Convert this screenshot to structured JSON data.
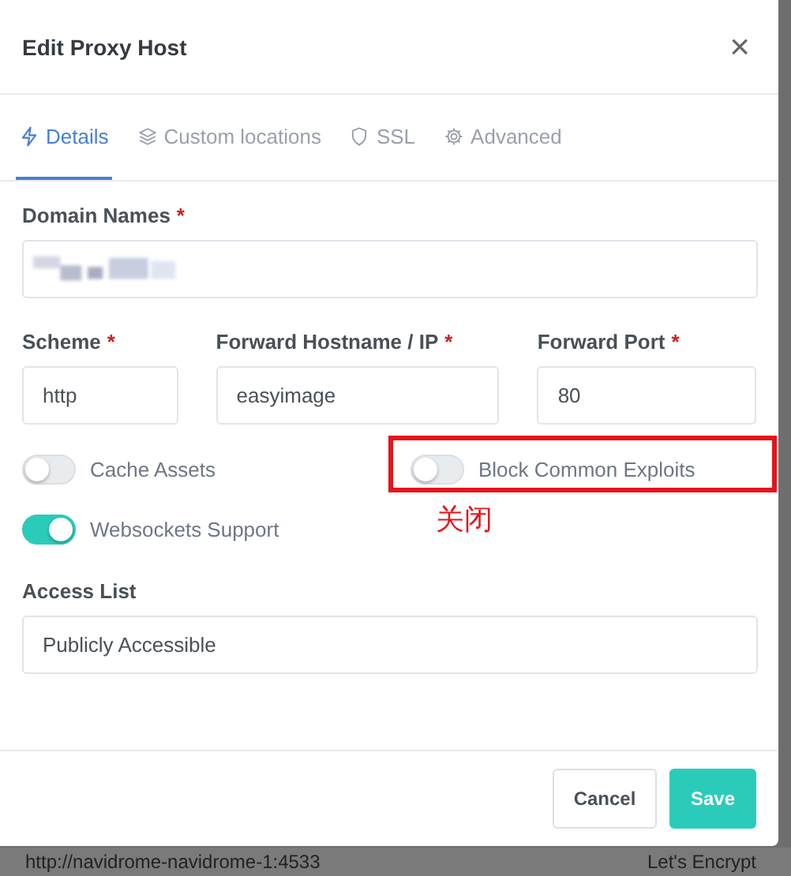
{
  "dialog": {
    "title": "Edit Proxy Host",
    "close": "×"
  },
  "tabs": [
    {
      "label": "Details",
      "selected": true
    },
    {
      "label": "Custom locations",
      "selected": false
    },
    {
      "label": "SSL",
      "selected": false
    },
    {
      "label": "Advanced",
      "selected": false
    }
  ],
  "domain_names": {
    "label": "Domain Names",
    "required_mark": "*"
  },
  "fields": [
    {
      "label": "Scheme",
      "required_mark": "*",
      "value": "http"
    },
    {
      "label": "Forward Hostname / IP",
      "required_mark": "*",
      "value": "easyimage"
    },
    {
      "label": "Forward Port",
      "required_mark": "*",
      "value": "80"
    }
  ],
  "toggles": [
    {
      "label": "Cache Assets",
      "on": false,
      "highlighted": false
    },
    {
      "label": "Block Common Exploits",
      "on": false,
      "highlighted": true
    },
    {
      "label": "Websockets Support",
      "on": true,
      "highlighted": false
    }
  ],
  "annotation": "关闭",
  "access_list": {
    "label": "Access List",
    "value": "Publicly Accessible"
  },
  "buttons": [
    {
      "label": "Cancel",
      "kind": "secondary"
    },
    {
      "label": "Save",
      "kind": "primary"
    }
  ],
  "background_row": [
    "http://navidrome-navidrome-1:4533",
    "Let's Encrypt"
  ]
}
